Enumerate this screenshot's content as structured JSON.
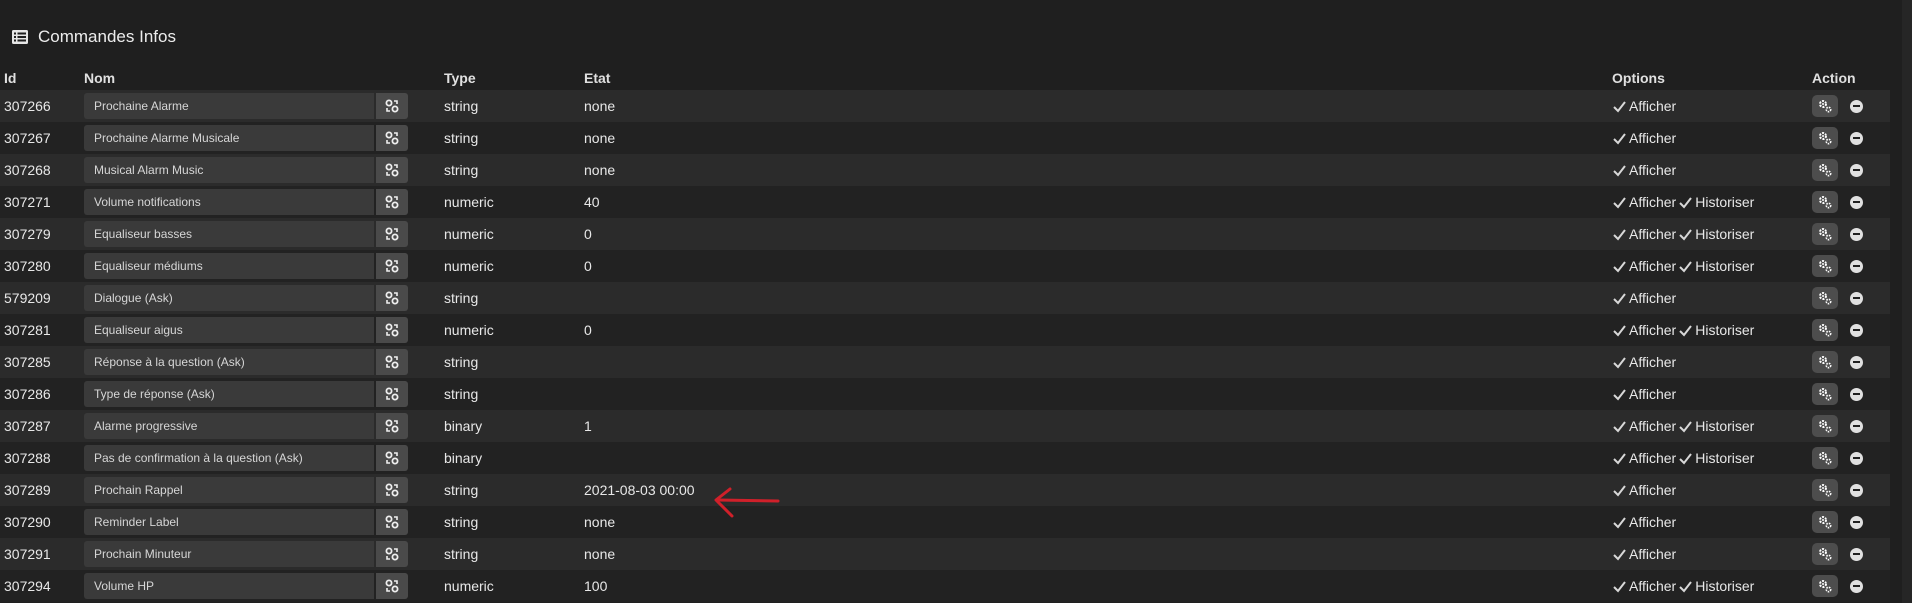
{
  "section": {
    "title": "Commandes Infos"
  },
  "headers": {
    "id": "Id",
    "nom": "Nom",
    "type": "Type",
    "etat": "Etat",
    "options": "Options",
    "action": "Action"
  },
  "rows": [
    {
      "id": "307266",
      "nom": "Prochaine Alarme",
      "type": "string",
      "etat": "none",
      "options": [
        "Afficher"
      ]
    },
    {
      "id": "307267",
      "nom": "Prochaine Alarme Musicale",
      "type": "string",
      "etat": "none",
      "options": [
        "Afficher"
      ]
    },
    {
      "id": "307268",
      "nom": "Musical Alarm Music",
      "type": "string",
      "etat": "none",
      "options": [
        "Afficher"
      ]
    },
    {
      "id": "307271",
      "nom": "Volume notifications",
      "type": "numeric",
      "etat": "40",
      "options": [
        "Afficher",
        "Historiser"
      ]
    },
    {
      "id": "307279",
      "nom": "Equaliseur basses",
      "type": "numeric",
      "etat": "0",
      "options": [
        "Afficher",
        "Historiser"
      ]
    },
    {
      "id": "307280",
      "nom": "Equaliseur médiums",
      "type": "numeric",
      "etat": "0",
      "options": [
        "Afficher",
        "Historiser"
      ]
    },
    {
      "id": "579209",
      "nom": "Dialogue (Ask)",
      "type": "string",
      "etat": "",
      "options": [
        "Afficher"
      ]
    },
    {
      "id": "307281",
      "nom": "Equaliseur aigus",
      "type": "numeric",
      "etat": "0",
      "options": [
        "Afficher",
        "Historiser"
      ]
    },
    {
      "id": "307285",
      "nom": "Réponse à la question (Ask)",
      "type": "string",
      "etat": "",
      "options": [
        "Afficher"
      ]
    },
    {
      "id": "307286",
      "nom": "Type de réponse (Ask)",
      "type": "string",
      "etat": "",
      "options": [
        "Afficher"
      ]
    },
    {
      "id": "307287",
      "nom": "Alarme progressive",
      "type": "binary",
      "etat": "1",
      "options": [
        "Afficher",
        "Historiser"
      ]
    },
    {
      "id": "307288",
      "nom": "Pas de confirmation à la question (Ask)",
      "type": "binary",
      "etat": "",
      "options": [
        "Afficher",
        "Historiser"
      ]
    },
    {
      "id": "307289",
      "nom": "Prochain Rappel",
      "type": "string",
      "etat": "2021-08-03 00:00",
      "options": [
        "Afficher"
      ]
    },
    {
      "id": "307290",
      "nom": "Reminder Label",
      "type": "string",
      "etat": "none",
      "options": [
        "Afficher"
      ]
    },
    {
      "id": "307291",
      "nom": "Prochain Minuteur",
      "type": "string",
      "etat": "none",
      "options": [
        "Afficher"
      ]
    },
    {
      "id": "307294",
      "nom": "Volume HP",
      "type": "numeric",
      "etat": "100",
      "options": [
        "Afficher",
        "Historiser"
      ]
    }
  ],
  "icons": {
    "section": "list-icon",
    "name_button": "configure-icon",
    "action_button": "gears-icon",
    "remove": "minus-circle-icon",
    "option": "check-icon",
    "annotation": "red-arrow-icon"
  },
  "colors": {
    "background": "#1f1f1f",
    "row_alt": "#2b2b2b",
    "annotation": "#d0202a"
  }
}
